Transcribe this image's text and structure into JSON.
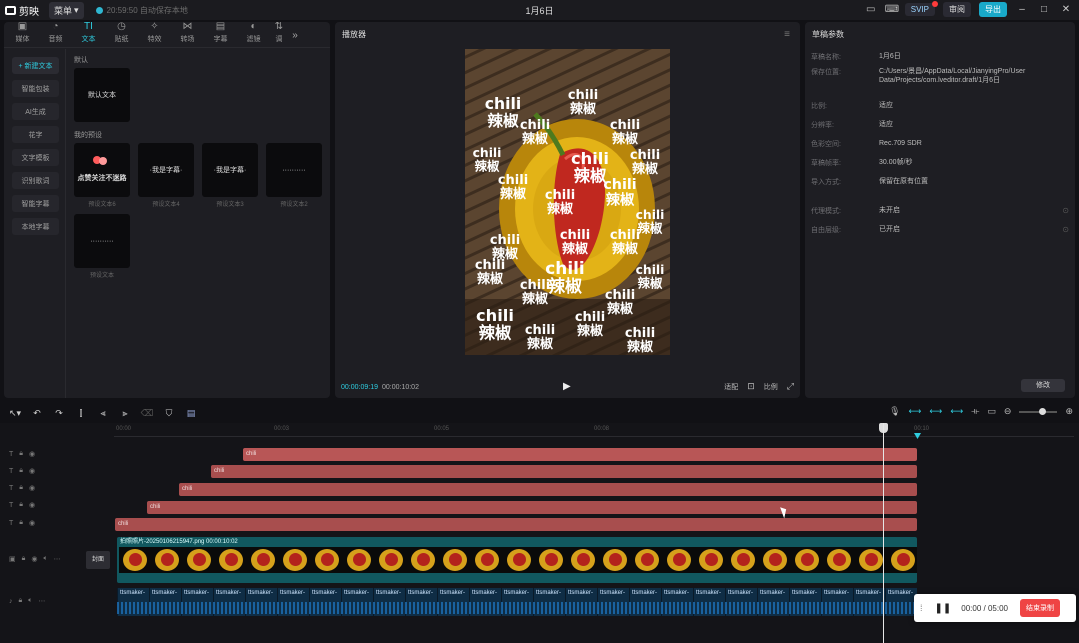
{
  "app": {
    "name": "剪映",
    "menu_label": "菜单",
    "autosave": "20:59:50 自动保存本地",
    "doc_title": "1月6日"
  },
  "titlebar": {
    "svip": "SVIP",
    "review": "审阅",
    "export": "导出"
  },
  "toolbar_tabs": [
    {
      "label": "媒体",
      "icon": "media-icon"
    },
    {
      "label": "音频",
      "icon": "audio-icon"
    },
    {
      "label": "文本",
      "icon": "text-icon"
    },
    {
      "label": "贴纸",
      "icon": "sticker-icon"
    },
    {
      "label": "特效",
      "icon": "effects-icon"
    },
    {
      "label": "转场",
      "icon": "transition-icon"
    },
    {
      "label": "字幕",
      "icon": "caption-icon"
    },
    {
      "label": "滤镜",
      "icon": "filter-icon"
    },
    {
      "label": "调",
      "icon": "adjust-icon"
    }
  ],
  "side_menu": [
    "+ 新建文本",
    "智能包装",
    "AI生成",
    "花字",
    "文字模板",
    "识别歌词",
    "智能字幕",
    "本地字幕"
  ],
  "media": {
    "default_label": "默认",
    "default_tile": "默认文本",
    "presets_label": "我的预设",
    "presets": [
      {
        "thumb": "点赞关注不迷路",
        "caption": "预设文本6"
      },
      {
        "thumb": "·我是字幕·",
        "caption": "预设文本4"
      },
      {
        "thumb": "·我是字幕·",
        "caption": "预设文本3"
      },
      {
        "thumb": "··········",
        "caption": "预设文本2"
      },
      {
        "thumb": "··········",
        "caption": "预设文本"
      }
    ]
  },
  "player": {
    "title": "播放器",
    "current_time": "00:00:09:19",
    "total_time": "00:00:10:02",
    "ratio_label": "适配",
    "proportion_label": "比例",
    "overlay_word_en": "chili",
    "overlay_word_cn": "辣椒"
  },
  "properties": {
    "title": "草稿参数",
    "rows": [
      {
        "key": "草稿名称:",
        "value": "1月6日"
      },
      {
        "key": "保存位置:",
        "value": "C:/Users/景昌/AppData/Local/JianyingPro/User Data/Projects/com.lveditor.draft/1月6日"
      },
      {
        "key": "比例:",
        "value": "适应"
      },
      {
        "key": "分辨率:",
        "value": "适应"
      },
      {
        "key": "色彩空间:",
        "value": "Rec.709 SDR"
      },
      {
        "key": "草稿帧率:",
        "value": "30.00帧/秒"
      },
      {
        "key": "导入方式:",
        "value": "保留在原有位置"
      },
      {
        "key": "代理模式:",
        "value": "未开启"
      },
      {
        "key": "自由层级:",
        "value": "已开启"
      }
    ],
    "modify": "修改"
  },
  "timeline": {
    "ruler": [
      "00:00",
      "00:03",
      "00:05",
      "00:08",
      "00:10"
    ],
    "text_clips": [
      "chili",
      "chili",
      "chili",
      "chili",
      "chili"
    ],
    "video_clip": "拍照照片-20250106215947.png  00:00:10:02",
    "cover": "封面",
    "audio_label": "ttsmaker-"
  },
  "recorder": {
    "time": "00:00 / 05:00",
    "stop": "结束录制"
  }
}
